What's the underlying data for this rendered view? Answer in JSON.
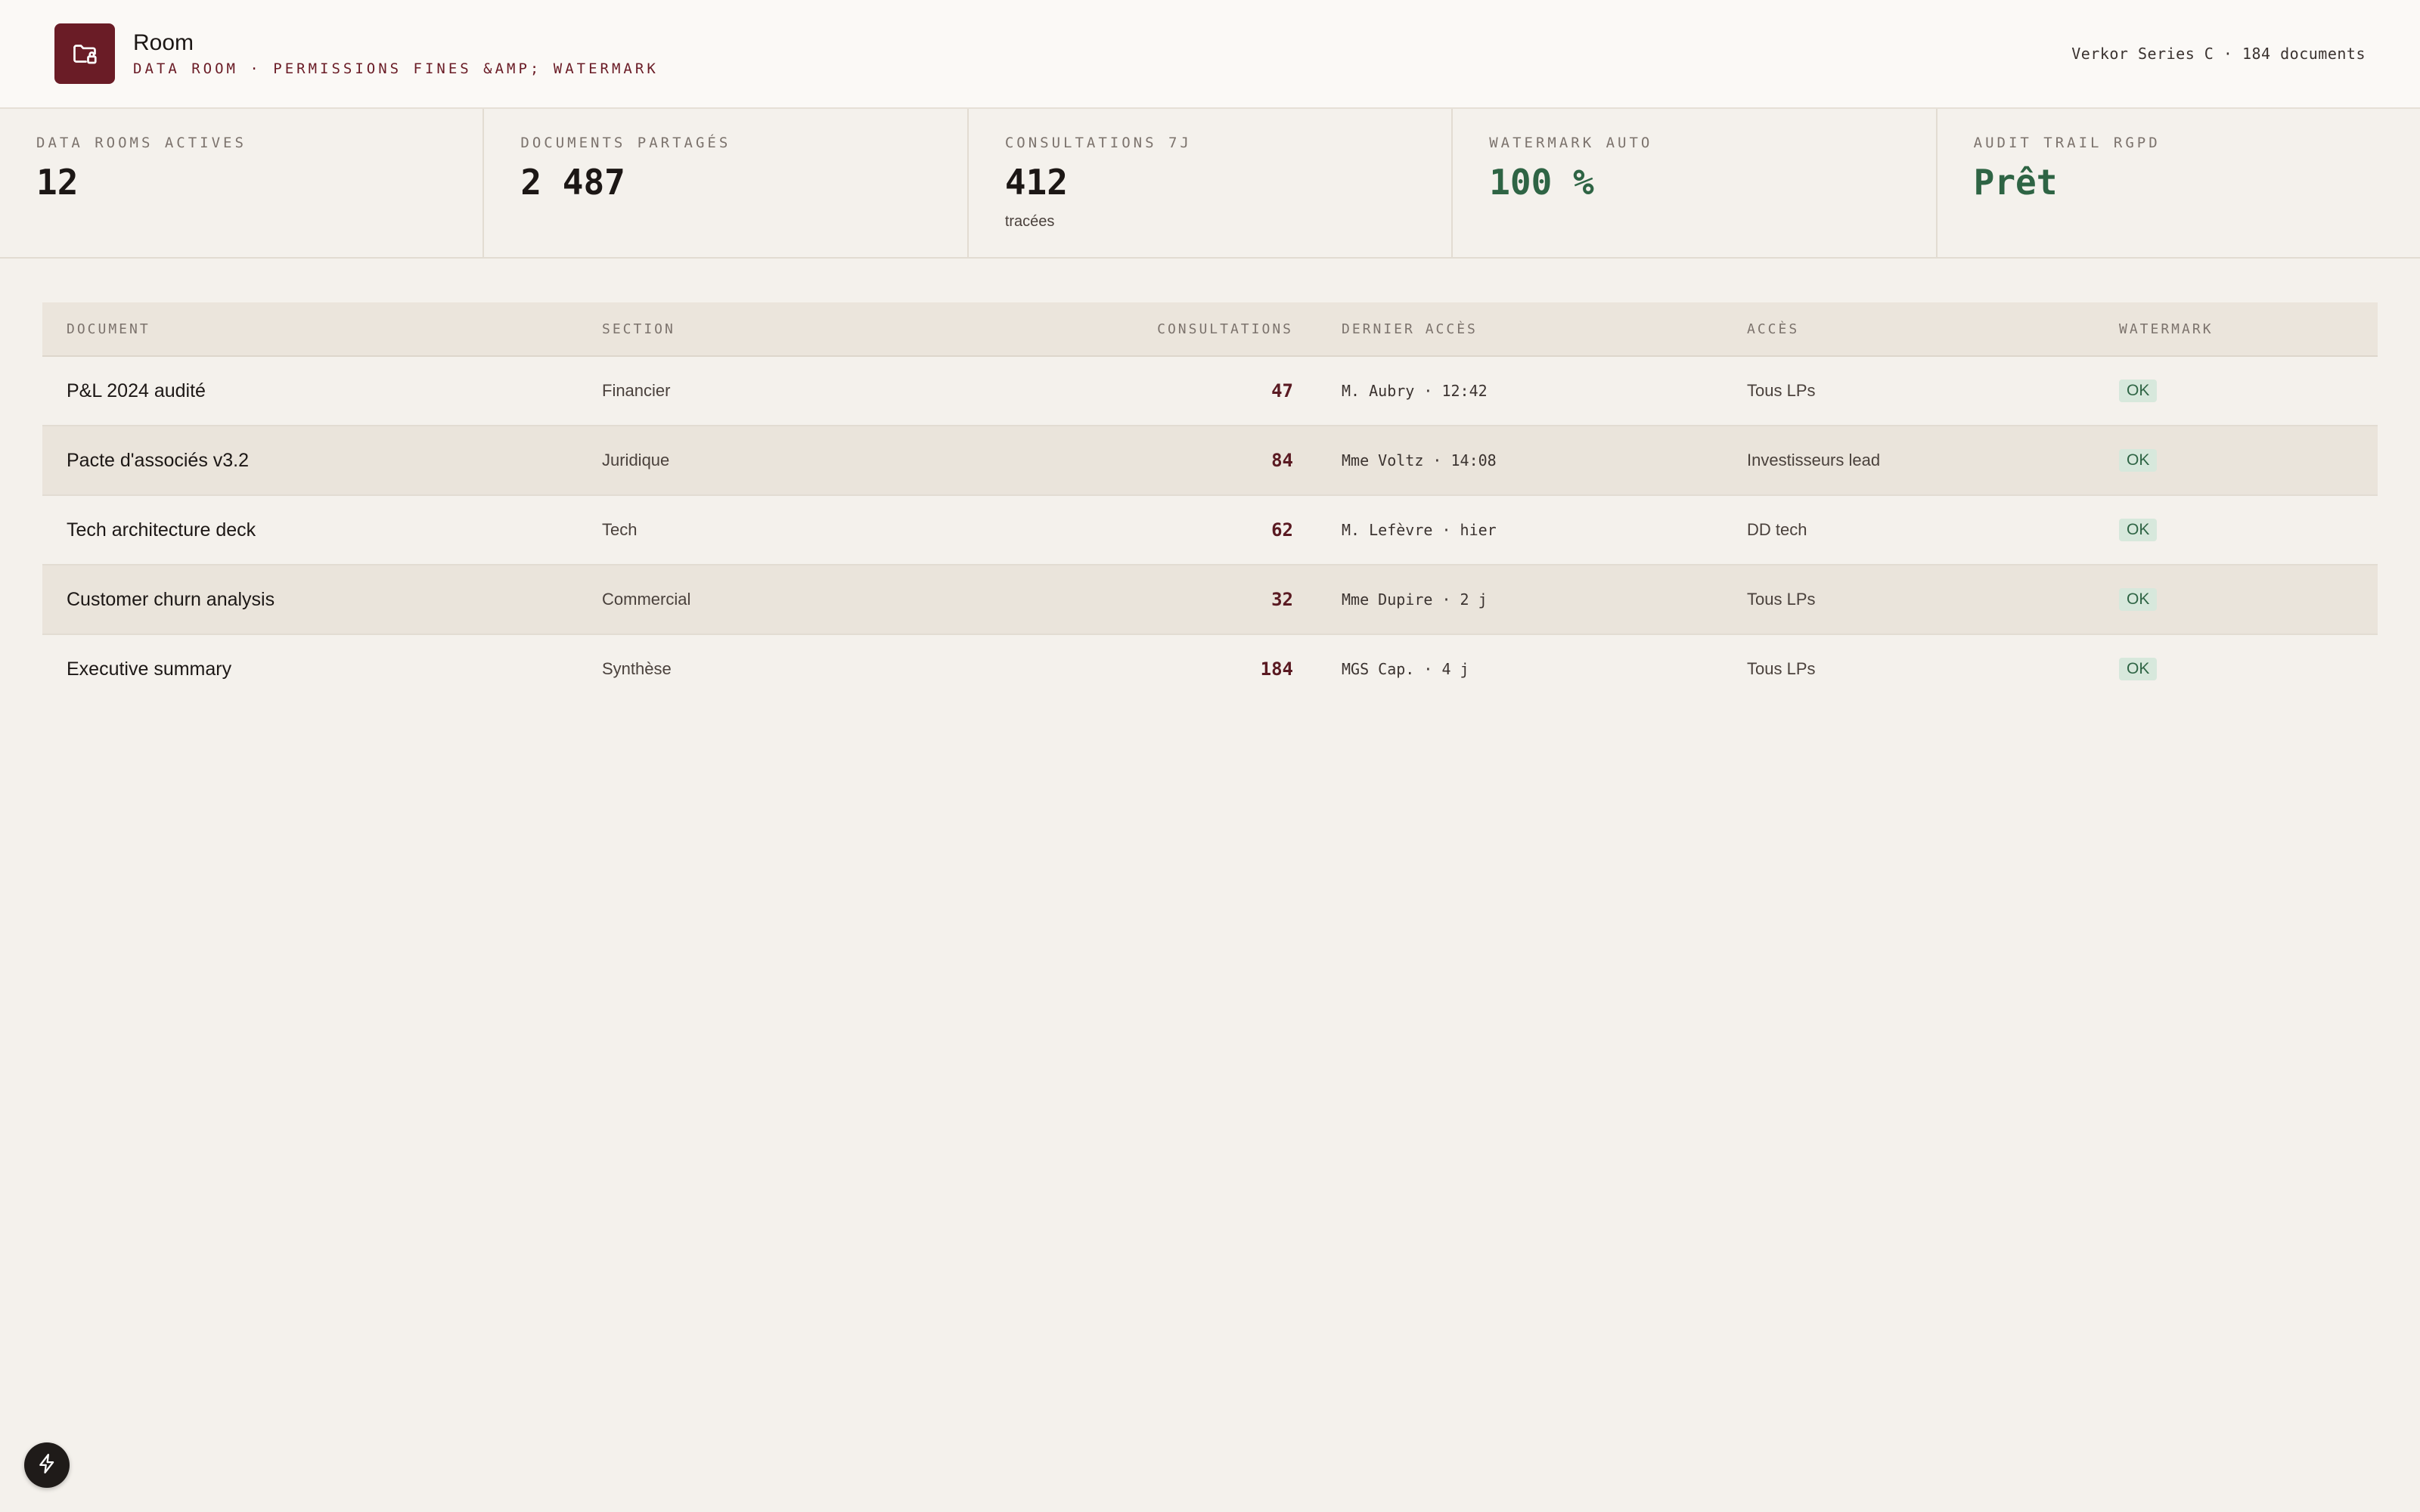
{
  "header": {
    "title": "Room",
    "subtitle": "Data room · permissions fines &amp; watermark",
    "meta": "Verkor Series C · 184 documents",
    "logo_icon": "folder-lock-icon",
    "brand_color": "#6a1c26"
  },
  "stats": [
    {
      "label": "Data rooms actives",
      "value": "12",
      "note": ""
    },
    {
      "label": "Documents partagés",
      "value": "2 487",
      "note": ""
    },
    {
      "label": "Consultations 7j",
      "value": "412",
      "note": "tracées"
    },
    {
      "label": "Watermark auto",
      "value": "100 %",
      "note": ""
    },
    {
      "label": "Audit trail RGPD",
      "value": "Prêt",
      "note": ""
    }
  ],
  "table": {
    "headers": {
      "document": "Document",
      "section": "Section",
      "consultations": "Consultations",
      "last_access": "Dernier accès",
      "access": "Accès",
      "watermark": "Watermark"
    },
    "rows": [
      {
        "document": "P&L 2024 audité",
        "section": "Financier",
        "consultations": "47",
        "last_access": "M. Aubry · 12:42",
        "access": "Tous LPs",
        "watermark": "OK"
      },
      {
        "document": "Pacte d'associés v3.2",
        "section": "Juridique",
        "consultations": "84",
        "last_access": "Mme Voltz · 14:08",
        "access": "Investisseurs lead",
        "watermark": "OK"
      },
      {
        "document": "Tech architecture deck",
        "section": "Tech",
        "consultations": "62",
        "last_access": "M. Lefèvre · hier",
        "access": "DD tech",
        "watermark": "OK"
      },
      {
        "document": "Customer churn analysis",
        "section": "Commercial",
        "consultations": "32",
        "last_access": "Mme Dupire · 2 j",
        "access": "Tous LPs",
        "watermark": "OK"
      },
      {
        "document": "Executive summary",
        "section": "Synthèse",
        "consultations": "184",
        "last_access": "MGS Cap. · 4 j",
        "access": "Tous LPs",
        "watermark": "OK"
      }
    ]
  },
  "fab": {
    "icon": "lightning-icon"
  },
  "colors": {
    "accent": "#6a1c26",
    "success": "#2e6444",
    "success_bg": "#d7e8dc",
    "background": "#f4f1ec"
  }
}
